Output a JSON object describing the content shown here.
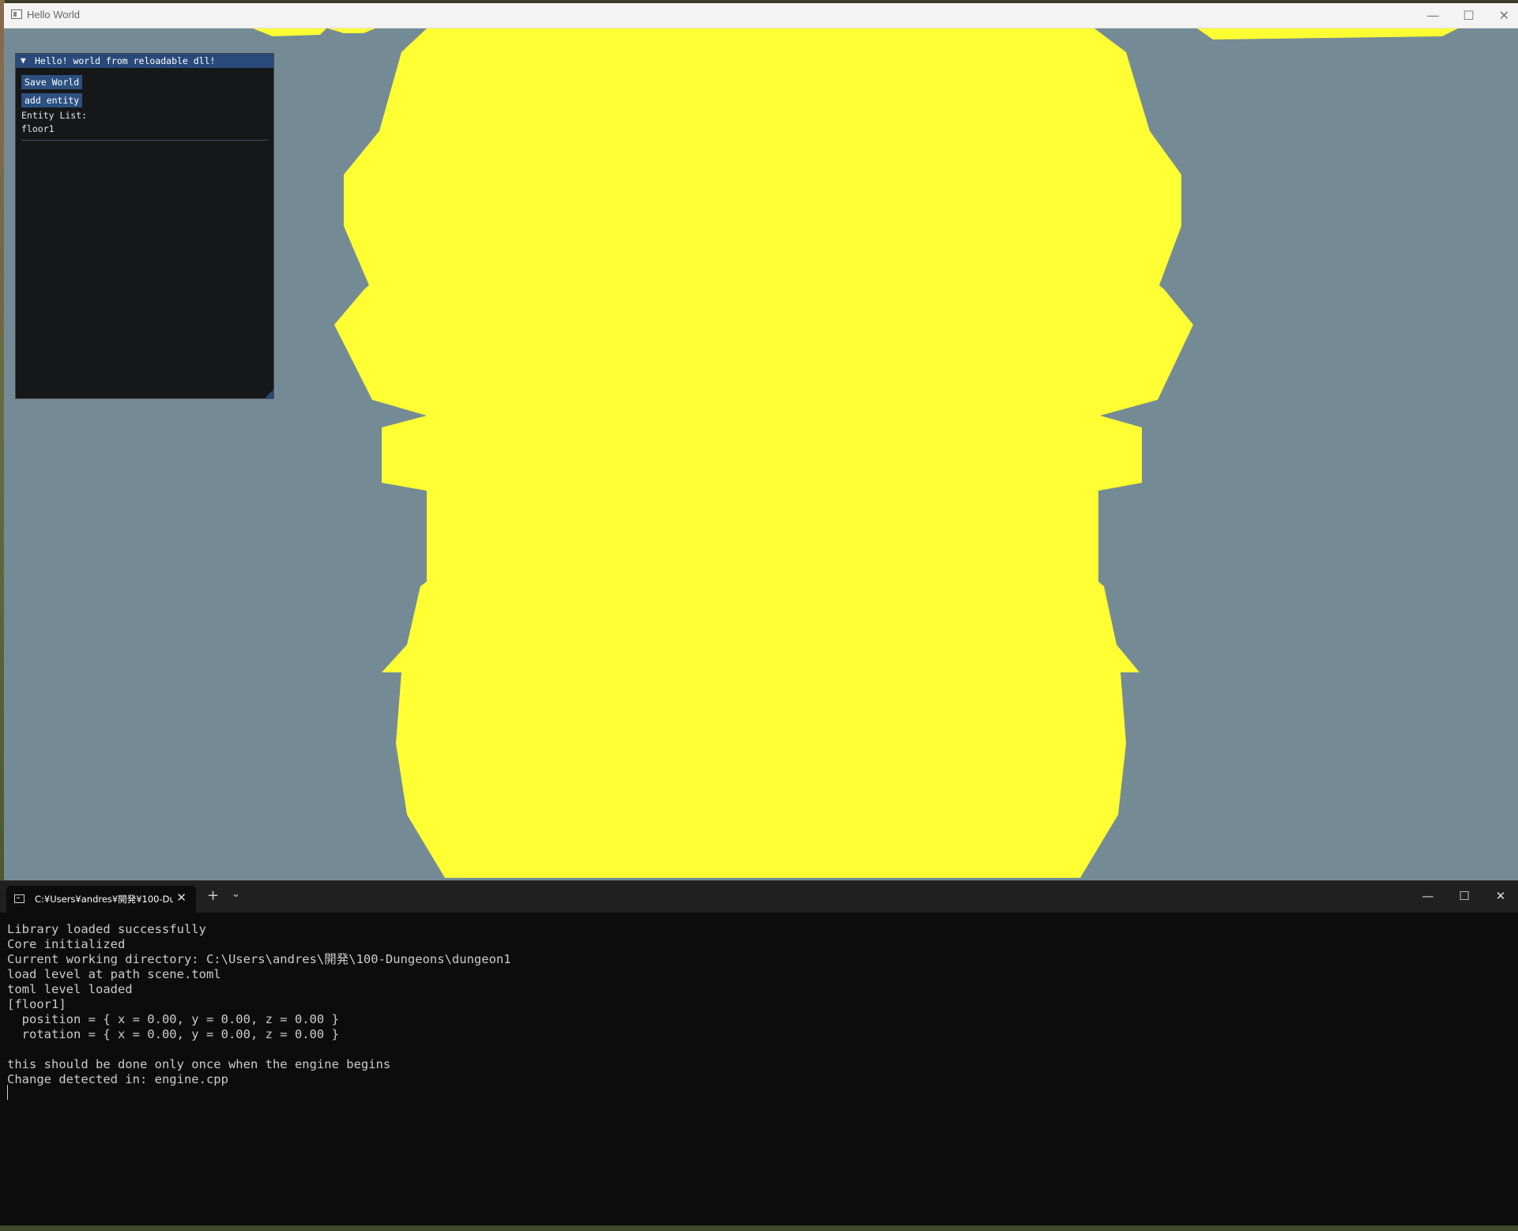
{
  "app_window": {
    "title": "Hello World",
    "controls": {
      "minimize": "—",
      "maximize": "☐",
      "close": "✕"
    }
  },
  "viewport": {
    "background_color": "#748b96",
    "shape_color": "#ffff33"
  },
  "imgui_panel": {
    "title": "Hello! world from reloadable dll!",
    "collapse_icon": "▼",
    "save_button": "Save World",
    "add_button": "add entity",
    "entity_list_label": "Entity List:",
    "entities": [
      "floor1"
    ]
  },
  "terminal": {
    "tab_title": "C:¥Users¥andres¥開発¥100-Du",
    "tab_close": "✕",
    "new_tab": "+",
    "dropdown": "⌄",
    "controls": {
      "minimize": "—",
      "maximize": "☐",
      "close": "✕"
    },
    "lines": [
      "Library loaded successfully",
      "Core initialized",
      "Current working directory: C:\\Users\\andres\\開発\\100-Dungeons\\dungeon1",
      "load level at path scene.toml",
      "toml level loaded",
      "[floor1]",
      "  position = { x = 0.00, y = 0.00, z = 0.00 }",
      "  rotation = { x = 0.00, y = 0.00, z = 0.00 }",
      "",
      "this should be done only once when the engine begins",
      "Change detected in: engine.cpp"
    ]
  }
}
